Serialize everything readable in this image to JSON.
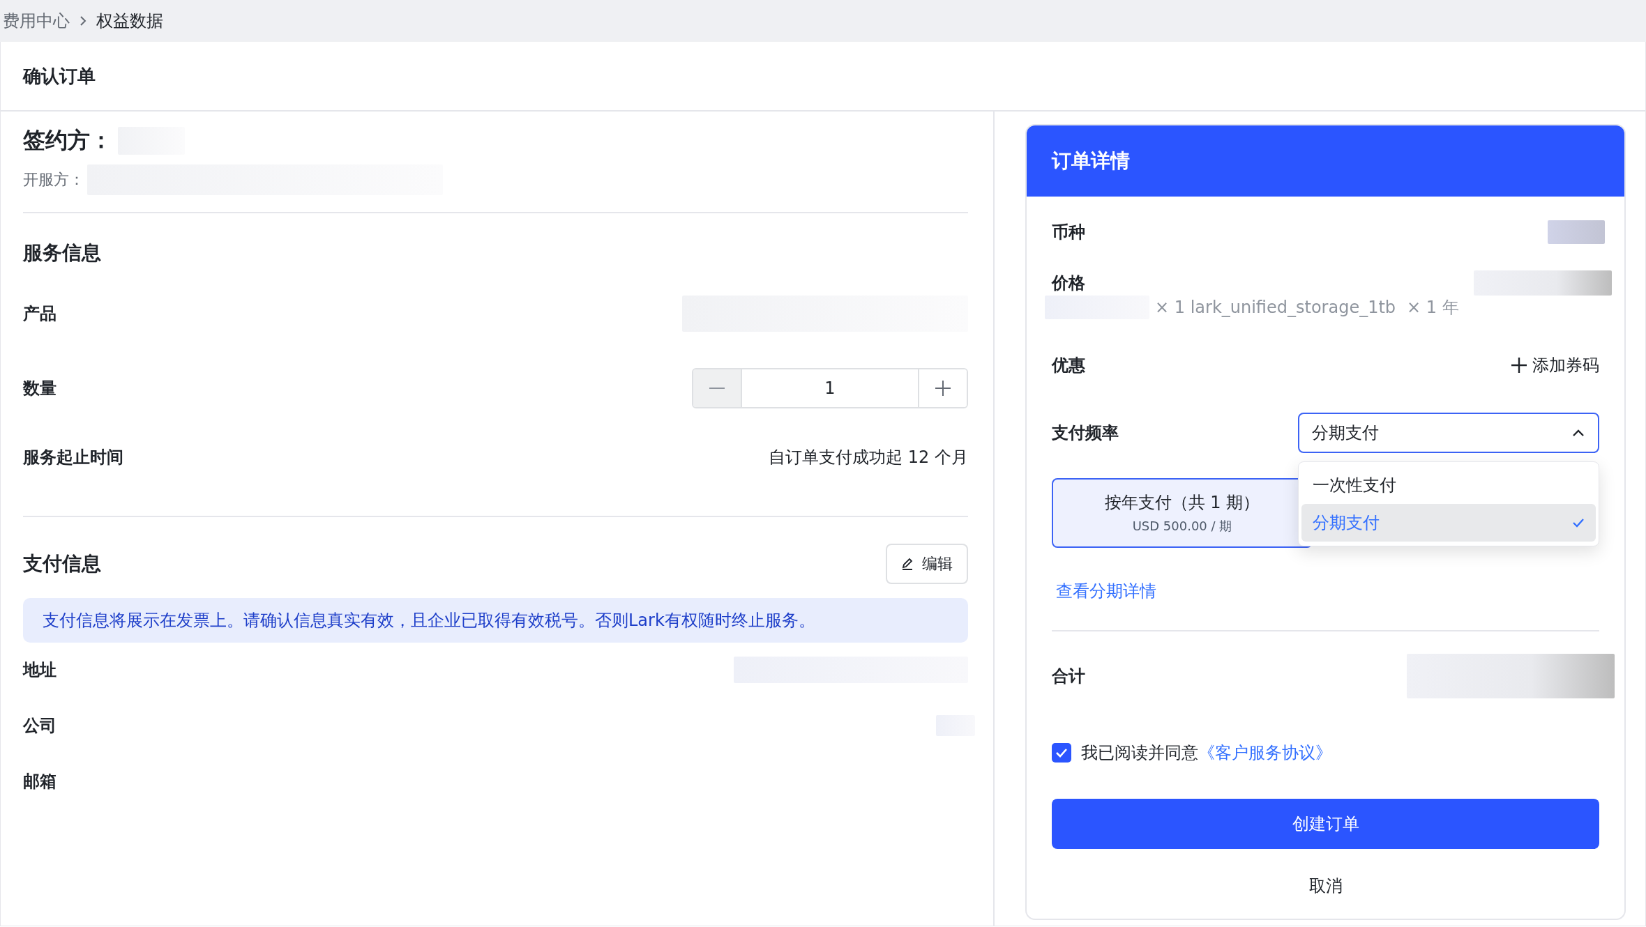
{
  "breadcrumb": [
    {
      "label": "费用中心",
      "current": false
    },
    {
      "label": "权益数据",
      "current": true
    }
  ],
  "page_title": "确认订单",
  "signatory": {
    "label": "签约方："
  },
  "provider": {
    "label": "开服方："
  },
  "service": {
    "title": "服务信息",
    "product_label": "产品",
    "quantity_label": "数量",
    "quantity": "1",
    "period_label": "服务起止时间",
    "period_value": "自订单支付成功起 12 个月"
  },
  "payment": {
    "title": "支付信息",
    "edit_button": "编辑",
    "notice": "支付信息将展示在发票上。请确认信息真实有效，且企业已取得有效税号。否则Lark有权随时终止服务。",
    "fields": [
      {
        "label": "地址"
      },
      {
        "label": "公司"
      },
      {
        "label": "邮箱"
      }
    ]
  },
  "order": {
    "title": "订单详情",
    "currency_label": "币种",
    "price_label": "价格",
    "price_item": "× 1 lark_unified_storage_1tb",
    "price_term": "× 1 年",
    "discount_label": "优惠",
    "add_coupon": "添加券码",
    "frequency_label": "支付频率",
    "frequency_select": {
      "value": "分期支付",
      "expanded": true,
      "options": [
        {
          "label": "一次性支付",
          "selected": false
        },
        {
          "label": "分期支付",
          "selected": true
        }
      ]
    },
    "plan": {
      "title": "按年支付（共 1 期）",
      "price": "USD 500.00 / 期",
      "selected": true
    },
    "plan_link": "查看分期详情",
    "total_label": "合计",
    "agreement": {
      "checked": true,
      "text": "我已阅读并同意",
      "link": "《客户服务协议》"
    },
    "create_button": "创建订单",
    "cancel_button": "取消"
  }
}
